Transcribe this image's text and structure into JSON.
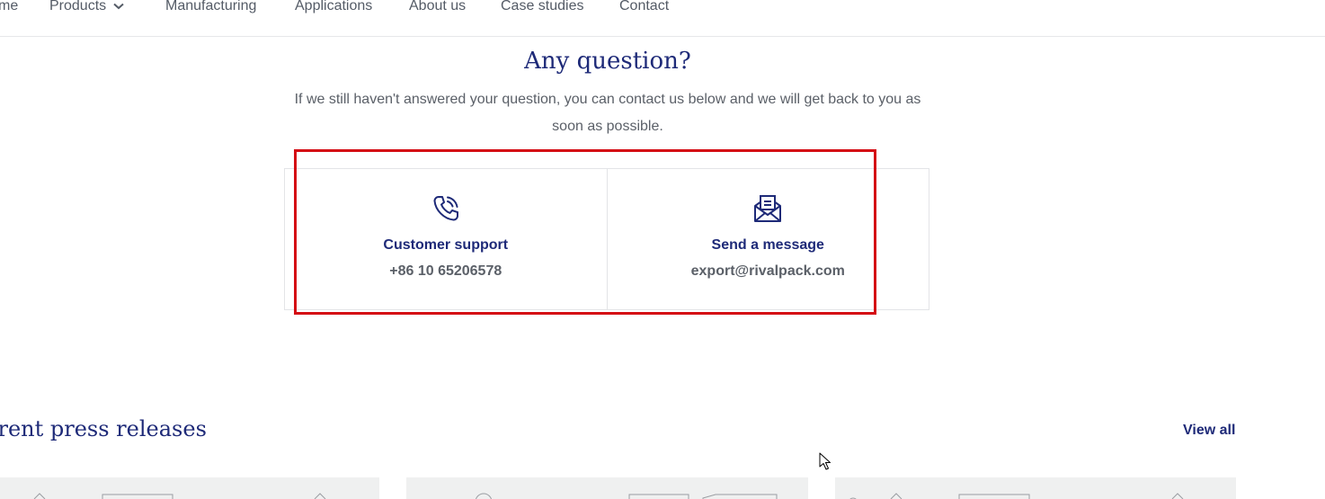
{
  "nav": {
    "items": [
      {
        "name": "nav-home",
        "label": "me"
      },
      {
        "name": "nav-products",
        "label": "Products"
      },
      {
        "name": "nav-manufacturing",
        "label": "Manufacturing"
      },
      {
        "name": "nav-applications",
        "label": "Applications"
      },
      {
        "name": "nav-about",
        "label": "About us"
      },
      {
        "name": "nav-case-studies",
        "label": "Case studies"
      },
      {
        "name": "nav-contact",
        "label": "Contact"
      }
    ]
  },
  "faq": {
    "title": "Any question?",
    "intro": "If we still haven't answered your question, you can contact us below and we will get back to you as soon as possible."
  },
  "contact": {
    "support": {
      "title": "Customer support",
      "value": "+86 10 65206578",
      "icon": "phone-icon"
    },
    "message": {
      "title": "Send a message",
      "value": "export@rivalpack.com",
      "icon": "envelope-icon"
    }
  },
  "press": {
    "title": "rrent press releases",
    "view_all": "View all"
  },
  "colors": {
    "brand": "#1e2a78",
    "text_muted": "#5b6068",
    "highlight": "#d40c14",
    "card_bg": "#eff0f0"
  }
}
